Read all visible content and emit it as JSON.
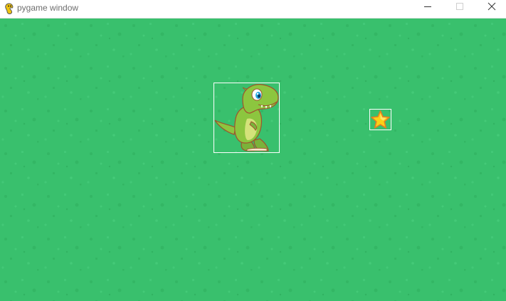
{
  "window": {
    "title": "pygame window",
    "app_icon": "pygame-snake-icon",
    "controls": {
      "minimize_icon": "minimize-icon",
      "maximize_icon": "maximize-icon",
      "close_icon": "close-icon"
    }
  },
  "game": {
    "background_color": "#39c06d",
    "background_pattern": "speckled-grass",
    "sprites": [
      {
        "name": "player",
        "icon": "green-dinosaur-icon",
        "outlined": true
      },
      {
        "name": "collectible",
        "icon": "yellow-star-icon",
        "outlined": true
      }
    ]
  }
}
